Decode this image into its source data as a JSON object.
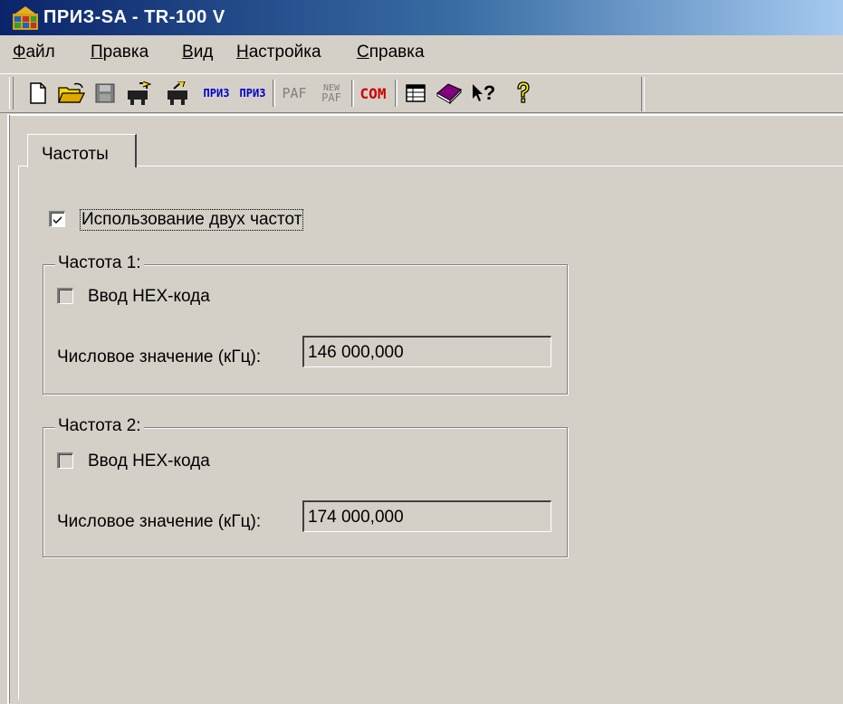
{
  "window": {
    "title": "ПРИЗ-SA - TR-100 V",
    "icon": "app-icon"
  },
  "menu": [
    {
      "label": "Файл",
      "underline": "Ф",
      "rest": "айл"
    },
    {
      "label": "Правка",
      "underline": "П",
      "rest": "равка"
    },
    {
      "label": "Вид",
      "underline": "В",
      "rest": "ид"
    },
    {
      "label": "Настройка",
      "underline": "Н",
      "rest": "астройка"
    },
    {
      "label": "Справка",
      "underline": "С",
      "rest": "правка"
    }
  ],
  "toolbar": {
    "buttons": [
      "new-file-icon",
      "open-folder-icon",
      "save-disk-icon",
      "read-device-icon",
      "write-device-icon",
      "priz-read-icon",
      "priz-write-icon",
      "paf-icon",
      "new-paf-icon",
      "com-port-icon",
      "table-icon",
      "book-icon",
      "context-help-icon",
      "about-icon"
    ],
    "priz1": "ПРИЗ",
    "priz2": "ПРИЗ",
    "paf": "PAF",
    "newpaf_top": "NEW",
    "newpaf_bottom": "PAF",
    "com": "COM",
    "question": "?",
    "colors": {
      "priz": "#0000cc",
      "com": "#cc0000",
      "disabled": "#808080",
      "help": "#ffff00"
    }
  },
  "tabs": [
    {
      "label": "Частоты"
    }
  ],
  "dual_freq": {
    "label": "Использование двух частот",
    "checked": true
  },
  "freq1": {
    "title": "Частота 1:",
    "hex_label": "Ввод HEX-кода",
    "hex_checked": false,
    "value_label": "Числовое значение (кГц):",
    "value": "146 000,000"
  },
  "freq2": {
    "title": "Частота 2:",
    "hex_label": "Ввод HEX-кода",
    "hex_checked": false,
    "value_label": "Числовое значение (кГц):",
    "value": "174 000,000"
  }
}
